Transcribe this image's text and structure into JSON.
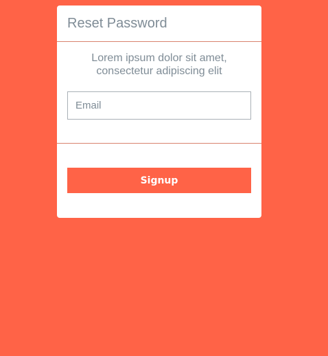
{
  "card": {
    "title": "Reset Password",
    "description_line1": "Lorem ipsum dolor sit amet,",
    "description_line2": "consectetur adipiscing elit"
  },
  "form": {
    "email_placeholder": "Email",
    "email_value": "",
    "submit_label": "Signup"
  },
  "colors": {
    "background": "#ff6347",
    "card": "#ffffff",
    "button": "#ff6347",
    "text_muted": "#7f8c96",
    "divider": "#d9826e"
  }
}
